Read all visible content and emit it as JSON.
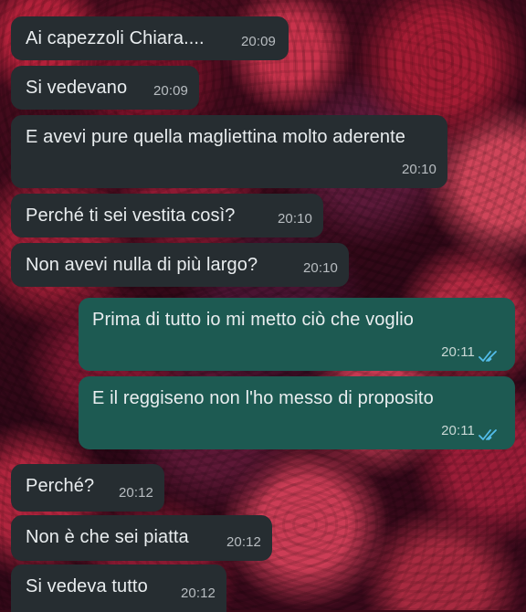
{
  "messages": [
    {
      "text": "Ai capezzoli Chiara....",
      "time": "20:09",
      "direction": "incoming"
    },
    {
      "text": "Si vedevano",
      "time": "20:09",
      "direction": "incoming"
    },
    {
      "text": "E avevi pure quella magliettina molto aderente",
      "time": "20:10",
      "direction": "incoming"
    },
    {
      "text": "Perché ti sei vestita così?",
      "time": "20:10",
      "direction": "incoming"
    },
    {
      "text": "Non avevi nulla di più largo?",
      "time": "20:10",
      "direction": "incoming"
    },
    {
      "text": "Prima di tutto io mi metto ciò che voglio",
      "time": "20:11",
      "direction": "outgoing",
      "status": "read"
    },
    {
      "text": "E il reggiseno non l'ho messo di proposito",
      "time": "20:11",
      "direction": "outgoing",
      "status": "read"
    },
    {
      "text": "Perché?",
      "time": "20:12",
      "direction": "incoming"
    },
    {
      "text": "Non è che sei piatta",
      "time": "20:12",
      "direction": "incoming"
    },
    {
      "text": "Si vedeva tutto",
      "time": "20:12",
      "direction": "incoming"
    }
  ],
  "colors": {
    "incoming_bubble": "#262d31",
    "outgoing_bubble": "#1d5a52",
    "read_ticks": "#53bdeb"
  }
}
